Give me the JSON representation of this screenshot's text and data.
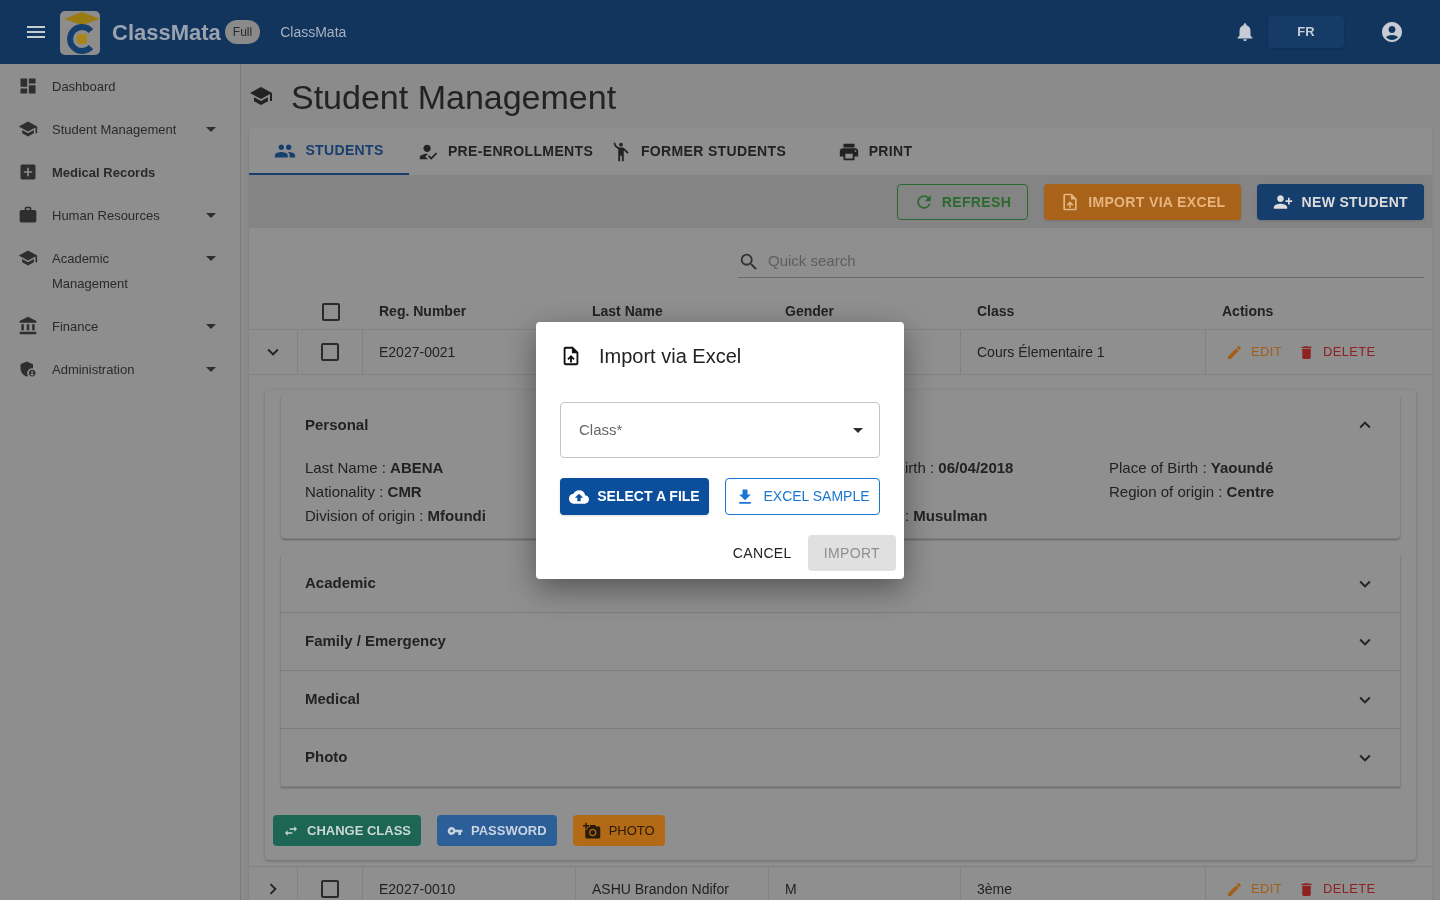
{
  "app": {
    "name": "ClassMata",
    "badge": "Full",
    "subtitle": "ClassMata",
    "language": "FR"
  },
  "sidebar": {
    "items": [
      {
        "label": "Dashboard",
        "selected": false,
        "expandable": false
      },
      {
        "label": "Student Management",
        "selected": false,
        "expandable": true
      },
      {
        "label": "Medical Records",
        "selected": true,
        "expandable": false
      },
      {
        "label": "Human Resources",
        "selected": false,
        "expandable": true
      },
      {
        "label": "Academic Management",
        "selected": false,
        "expandable": true
      },
      {
        "label": "Finance",
        "selected": false,
        "expandable": true
      },
      {
        "label": "Administration",
        "selected": false,
        "expandable": true
      }
    ]
  },
  "page": {
    "title": "Student Management"
  },
  "tabs": [
    {
      "label": "STUDENTS",
      "selected": true
    },
    {
      "label": "PRE-ENROLLMENTS",
      "selected": false
    },
    {
      "label": "FORMER STUDENTS",
      "selected": false
    },
    {
      "label": "PRINT",
      "selected": false
    }
  ],
  "toolbar": {
    "buttons": [
      {
        "label": "REFRESH",
        "kind": "refresh"
      },
      {
        "label": "IMPORT VIA EXCEL",
        "kind": "import"
      },
      {
        "label": "NEW STUDENT",
        "kind": "new"
      }
    ]
  },
  "search": {
    "placeholder": "Quick search"
  },
  "table": {
    "select_all_checked": false,
    "columns": [
      "Reg. Number",
      "Last Name",
      "Gender",
      "Class",
      "Actions"
    ],
    "rows": [
      {
        "expanded": true,
        "checked": false,
        "reg_number": "E2027-0021",
        "class_name": "Cours Élementaire 1",
        "edit": "EDIT",
        "delete": "DELETE"
      },
      {
        "expanded": false,
        "checked": false,
        "reg_number": "E2027-0010",
        "last_name": "ASHU Brandon Ndifor",
        "gender": "M",
        "class_name": "3ème",
        "edit": "EDIT",
        "delete": "DELETE"
      }
    ]
  },
  "details": {
    "sections": [
      {
        "title": "Personal",
        "expanded": true,
        "columns": [
          [
            {
              "label": "Last Name :",
              "value": "ABENA"
            },
            {
              "label": "Nationality :",
              "value": "CMR"
            },
            {
              "label": "Division of origin :",
              "value": "Mfoundi"
            }
          ],
          [
            {
              "label": "irth :",
              "value": "06/04/2018"
            },
            {
              "label": ":",
              "value": "Musulman"
            }
          ],
          [
            {
              "label": "Place of Birth :",
              "value": "Yaoundé"
            },
            {
              "label": "Region of origin :",
              "value": "Centre"
            }
          ]
        ]
      },
      {
        "title": "Academic",
        "expanded": false
      },
      {
        "title": "Family / Emergency",
        "expanded": false
      },
      {
        "title": "Medical",
        "expanded": false
      },
      {
        "title": "Photo",
        "expanded": false
      }
    ],
    "buttons": [
      {
        "label": "CHANGE CLASS",
        "kind": "change_class"
      },
      {
        "label": "PASSWORD",
        "kind": "password"
      },
      {
        "label": "PHOTO",
        "kind": "photo"
      }
    ]
  },
  "dialog": {
    "title": "Import via Excel",
    "select": {
      "placeholder": "Class*"
    },
    "buttons": [
      {
        "label": "SELECT A FILE",
        "kind": "primary"
      },
      {
        "label": "EXCEL SAMPLE",
        "kind": "outlined"
      }
    ],
    "actions": [
      {
        "label": "CANCEL",
        "disabled": false
      },
      {
        "label": "IMPORT",
        "disabled": true
      }
    ]
  }
}
